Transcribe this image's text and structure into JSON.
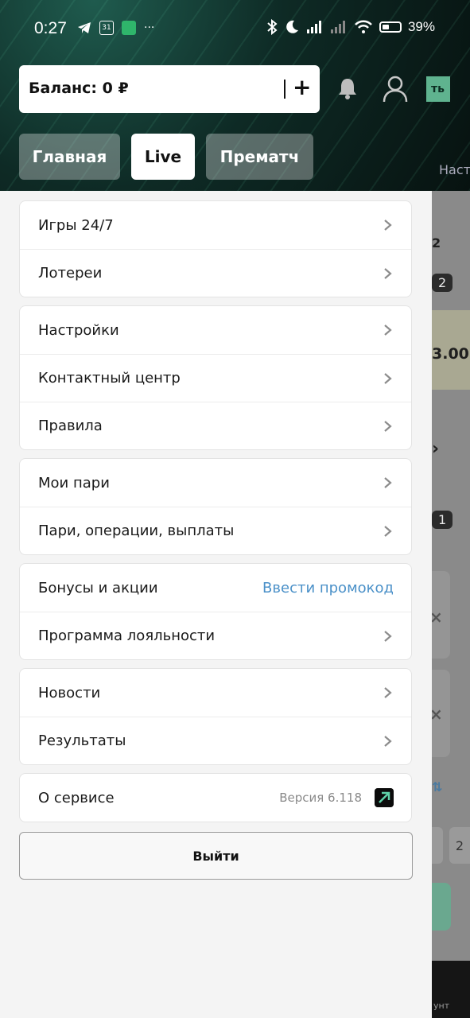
{
  "status_bar": {
    "time": "0:27",
    "calendar_day": "31",
    "more": "···",
    "battery": "39%"
  },
  "header": {
    "balance": "Баланс: 0 ₽",
    "add": "+",
    "right_tag": "ть",
    "peek_tab": "Наст"
  },
  "tabs": [
    {
      "label": "Главная",
      "active": false
    },
    {
      "label": "Live",
      "active": true
    },
    {
      "label": "Прематч",
      "active": false
    }
  ],
  "menu": {
    "group1": [
      "Игры 24/7",
      "Лотереи"
    ],
    "group2": [
      "Настройки",
      "Контактный центр",
      "Правила"
    ],
    "group3": [
      "Мои пари",
      "Пари, операции, выплаты"
    ],
    "group4": {
      "bonuses": "Бонусы и акции",
      "promo_link": "Ввести промокод",
      "loyalty": "Программа лояльности"
    },
    "group5": [
      "Новости",
      "Результаты"
    ],
    "group6": {
      "about": "О сервисе",
      "version": "Версия 6.118"
    },
    "logout": "Выйти"
  },
  "background": {
    "peek_1": "2",
    "peek_2": "2",
    "peek_odds": "3.00",
    "peek_3": "1",
    "peek_4": "2",
    "peek_nav": "унт"
  },
  "colors": {
    "accent_link": "#4a90c8",
    "brand_green": "#5fb38f"
  }
}
